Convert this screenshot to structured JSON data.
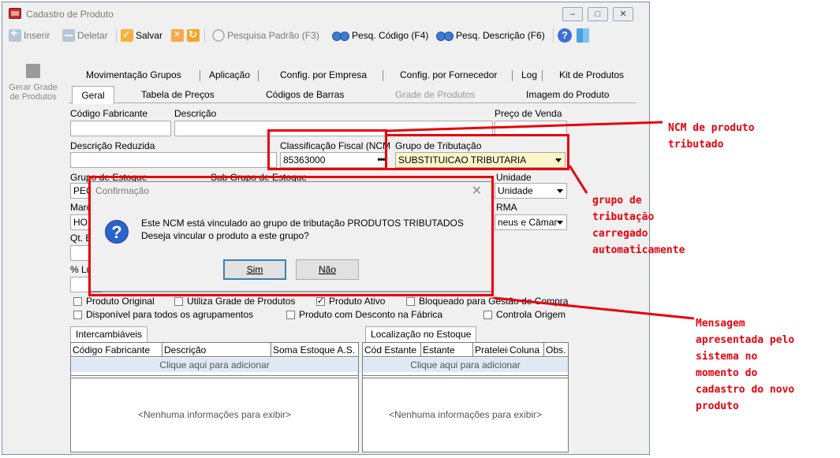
{
  "window": {
    "title": "Cadastro de Produto",
    "controls": [
      "–",
      "□",
      "✕"
    ]
  },
  "toolbar": {
    "insert": "Inserir",
    "delete": "Deletar",
    "save": "Salvar",
    "search_default": "Pesquisa Padrão (F3)",
    "search_code": "Pesq. Código (F4)",
    "search_desc": "Pesq. Descrição (F6)"
  },
  "left_panel": {
    "grid_button": "Gerar Grade de Produtos"
  },
  "tabs_row1": [
    "Movimentação Grupos",
    "Aplicação",
    "Config. por Empresa",
    "Config. por Fornecedor",
    "Log",
    "Kit de Produtos"
  ],
  "tabs_row2": [
    "Geral",
    "Tabela de Preços",
    "Códigos de Barras",
    "Grade de Produtos",
    "Imagem do Produto"
  ],
  "form": {
    "codigo_fabricante_label": "Código Fabricante",
    "descricao_label": "Descrição",
    "preco_venda_label": "Preço de Venda",
    "descricao_reduzida_label": "Descrição Reduzida",
    "classificacao_fiscal_label": "Classificação Fiscal (NCM",
    "classificacao_fiscal_value": "85363000",
    "grupo_tributacao_label": "Grupo de Tributação",
    "grupo_tributacao_value": "SUBSTITUICAO TRIBUTARIA",
    "grupo_estoque_label": "Grupo de Estoque",
    "sub_grupo_label": "Sub Grupo de Estoque",
    "grupo_estoque_value_partial": "PEC",
    "unidade_label": "Unidade",
    "unidade_value": "Unidade",
    "marca_label_partial": "Marc",
    "marca_value_partial": "HOI",
    "rma_label_partial": "RMA",
    "rma_value": "neus e Câmar",
    "qt_label_partial": "Qt. E",
    "lucro_label_partial": "% Lu",
    "ellipsis": "•••"
  },
  "checkboxes": [
    {
      "label": "Produto Original",
      "checked": false
    },
    {
      "label": "Utiliza Grade de Produtos",
      "checked": false
    },
    {
      "label": "Produto Ativo",
      "checked": true
    },
    {
      "label": "Bloqueado para Gestão de Compra",
      "checked": false
    },
    {
      "label": "Disponível para todos os agrupamentos",
      "checked": false
    },
    {
      "label": "Produto com Desconto na Fábrica",
      "checked": false
    },
    {
      "label": "Controla Origem",
      "checked": false
    }
  ],
  "grid_left": {
    "tab": "Intercambiáveis",
    "columns": [
      "Código Fabricante",
      "Descrição",
      "Soma Estoque A.S."
    ],
    "add_row": "Clique aqui para adicionar",
    "empty": "<Nenhuma informações para exibir>"
  },
  "grid_right": {
    "tab": "Localização no Estoque",
    "columns": [
      "Cód Estante",
      "Estante",
      "Prateleira",
      "Coluna",
      "Obs."
    ],
    "add_row": "Clique aqui para adicionar",
    "empty": "<Nenhuma informações para exibir>"
  },
  "dialog": {
    "title": "Confirmação",
    "close": "✕",
    "icon": "?",
    "line1": "Este NCM está vinculado ao grupo de tributação PRODUTOS TRIBUTADOS",
    "line2": "Deseja vincular o produto a este grupo?",
    "yes": "Sim",
    "no": "Não"
  },
  "annotations": {
    "ncm_line1": "NCM de produto",
    "ncm_line2": "tributado",
    "grupo": [
      "grupo de",
      "tributação",
      "carregado",
      "automaticamente"
    ],
    "mensagem": [
      "Mensagem",
      "apresentada pelo",
      "sistema no",
      "momento do",
      "cadastro do novo",
      "produto"
    ],
    "color": "#e8000b"
  }
}
